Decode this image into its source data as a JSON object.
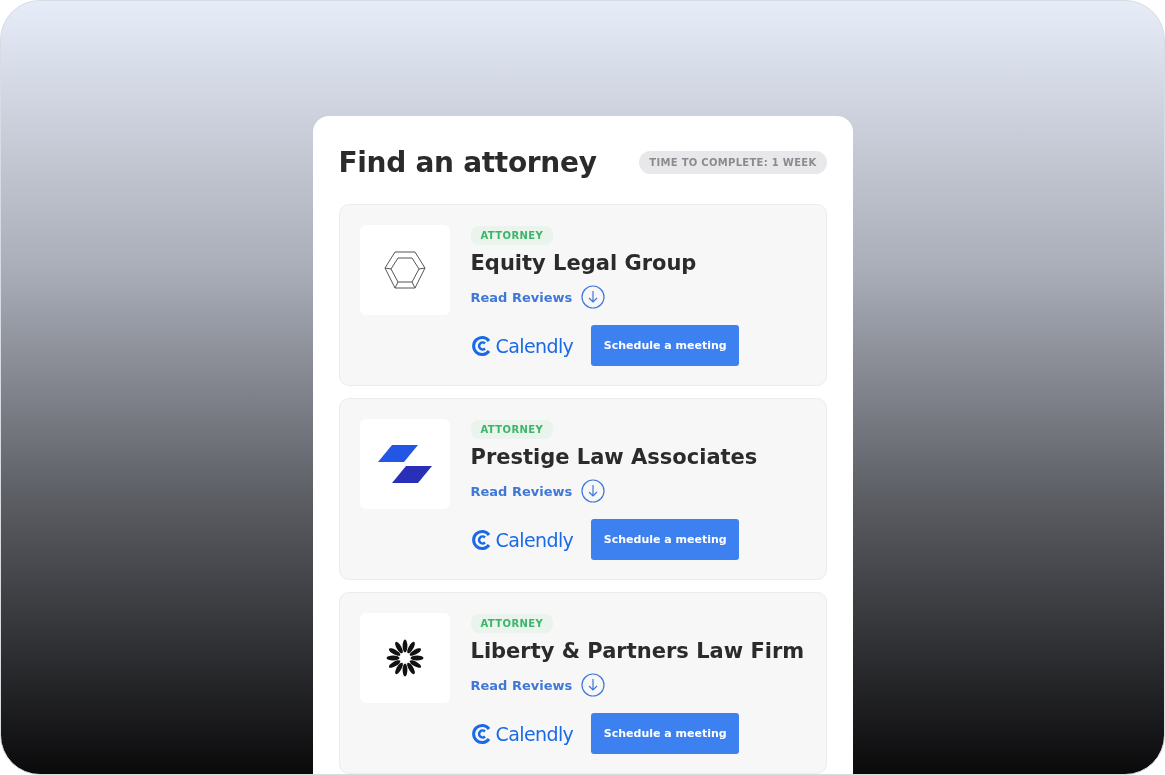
{
  "panel": {
    "title": "Find an attorney",
    "badge": "TIME TO COMPLETE: 1 WEEK"
  },
  "attorneys": [
    {
      "logo": {
        "kind": "hexagon"
      },
      "tag": "ATTORNEY",
      "name": "Equity Legal Group",
      "reviews_link": "Read Reviews",
      "calendar_brand": "Calendly",
      "button": "Schedule a meeting"
    },
    {
      "logo": {
        "kind": "parallelogram"
      },
      "tag": "ATTORNEY",
      "name": "Prestige Law Associates",
      "reviews_link": "Read Reviews",
      "calendar_brand": "Calendly",
      "button": "Schedule a meeting"
    },
    {
      "logo": {
        "kind": "burst"
      },
      "tag": "ATTORNEY",
      "name": "Liberty & Partners Law Firm",
      "reviews_link": "Read Reviews",
      "calendar_brand": "Calendly",
      "button": "Schedule a meeting"
    }
  ]
}
